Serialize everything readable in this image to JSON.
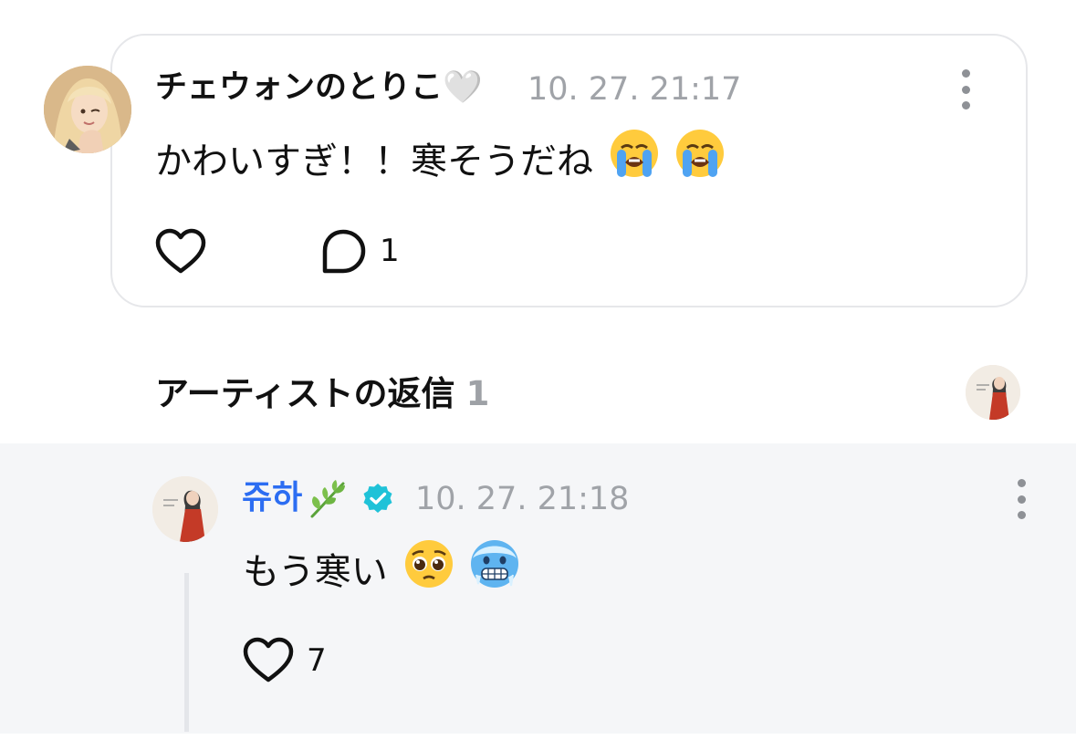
{
  "fan_comment": {
    "author": "チェウォンのとりこ🤍",
    "timestamp": "10. 27. 21:17",
    "text": "かわいすぎ！！寒そうだね",
    "emojis": [
      "loudly-crying-face",
      "loudly-crying-face"
    ],
    "reply_count": "1"
  },
  "artist_replies": {
    "title": "アーティストの返信",
    "count": "1"
  },
  "artist_reply": {
    "author": "쥬하",
    "author_badges": [
      "herb-icon",
      "verified-badge-icon"
    ],
    "timestamp": "10. 27. 21:18",
    "text": "もう寒い",
    "emojis": [
      "pleading-face",
      "cold-face"
    ],
    "like_count": "7"
  },
  "colors": {
    "artist_name": "#2c6df2",
    "verified_badge": "#1fc2d8",
    "timestamp": "#a0a3a8",
    "card_border": "#e6e7ea",
    "reply_background": "#f5f6f8"
  }
}
